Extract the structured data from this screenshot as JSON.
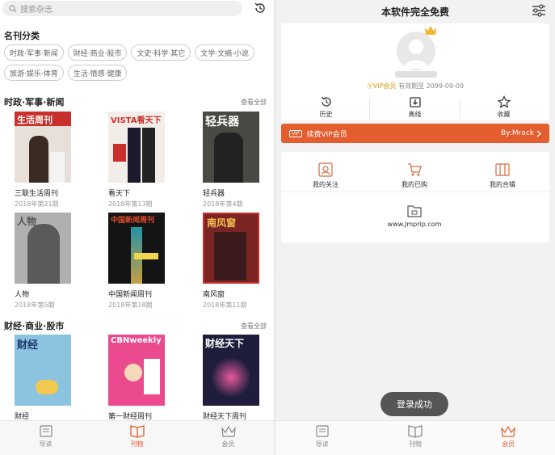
{
  "left": {
    "search_placeholder": "搜索杂志",
    "category_title": "名刊分类",
    "tags": [
      "时政·军事·新闻",
      "财经·商业·股市",
      "文史·科学·其它",
      "文学·文摘·小说",
      "旅游·娱乐·体育",
      "生活·情感·健康"
    ],
    "section1": {
      "title": "时政·军事·新闻",
      "see_all": "查看全部",
      "items": [
        {
          "name": "三联生活周刊",
          "issue": "2018年第21期",
          "cover_title": "生活周刊",
          "cover_color": "#e8e0d8"
        },
        {
          "name": "看天下",
          "issue": "2018年第13期",
          "cover_title": "VISTA看天下",
          "cover_color": "#d8d0c8"
        },
        {
          "name": "轻兵器",
          "issue": "2018年第4期",
          "cover_title": "轻兵器",
          "cover_color": "#5a5a52"
        },
        {
          "name": "人物",
          "issue": "2018年第5期",
          "cover_title": "人物",
          "cover_color": "#9a9a9a"
        },
        {
          "name": "中国新闻周刊",
          "issue": "2018年第18期",
          "cover_title": "中国新闻周刊",
          "cover_color": "#1a1a1a"
        },
        {
          "name": "南风窗",
          "issue": "2018年第11期",
          "cover_title": "南风窗",
          "cover_color": "#8a2a2a"
        }
      ]
    },
    "section2": {
      "title": "财经·商业·股市",
      "see_all": "查看全部",
      "items": [
        {
          "name": "财经",
          "cover_title": "财经",
          "cover_color": "#7fb7d6"
        },
        {
          "name": "第一财经周刊",
          "cover_title": "CBNweekly",
          "cover_color": "#e8478a"
        },
        {
          "name": "财经天下周刊",
          "cover_title": "财经天下",
          "cover_color": "#1a1a3a"
        }
      ]
    },
    "tabs": [
      {
        "label": "导读",
        "icon": "book-icon"
      },
      {
        "label": "刊物",
        "icon": "open-book-icon"
      },
      {
        "label": "会员",
        "icon": "crown-icon"
      }
    ]
  },
  "right": {
    "title": "本软件完全免费",
    "vip_label": "VIP会员",
    "vip_expiry": "有效期至 2099-09-09",
    "quick": [
      {
        "label": "历史",
        "icon": "history-icon"
      },
      {
        "label": "离线",
        "icon": "download-icon"
      },
      {
        "label": "收藏",
        "icon": "star-icon"
      }
    ],
    "banner_text": "续费VIP会员",
    "banner_tag": "VIP",
    "banner_right": "By:Mrack",
    "grid": [
      {
        "label": "我的关注",
        "icon": "follow-icon"
      },
      {
        "label": "我的已购",
        "icon": "cart-icon"
      },
      {
        "label": "我的合辑",
        "icon": "collection-icon"
      },
      {
        "label": "www.Jmprip.com",
        "icon": "folder-icon"
      }
    ],
    "toast": "登录成功",
    "tabs": [
      {
        "label": "导读",
        "icon": "book-icon"
      },
      {
        "label": "刊物",
        "icon": "open-book-icon"
      },
      {
        "label": "会员",
        "icon": "crown-icon"
      }
    ]
  },
  "colors": {
    "accent": "#e35d2e",
    "gold": "#d4a017"
  }
}
